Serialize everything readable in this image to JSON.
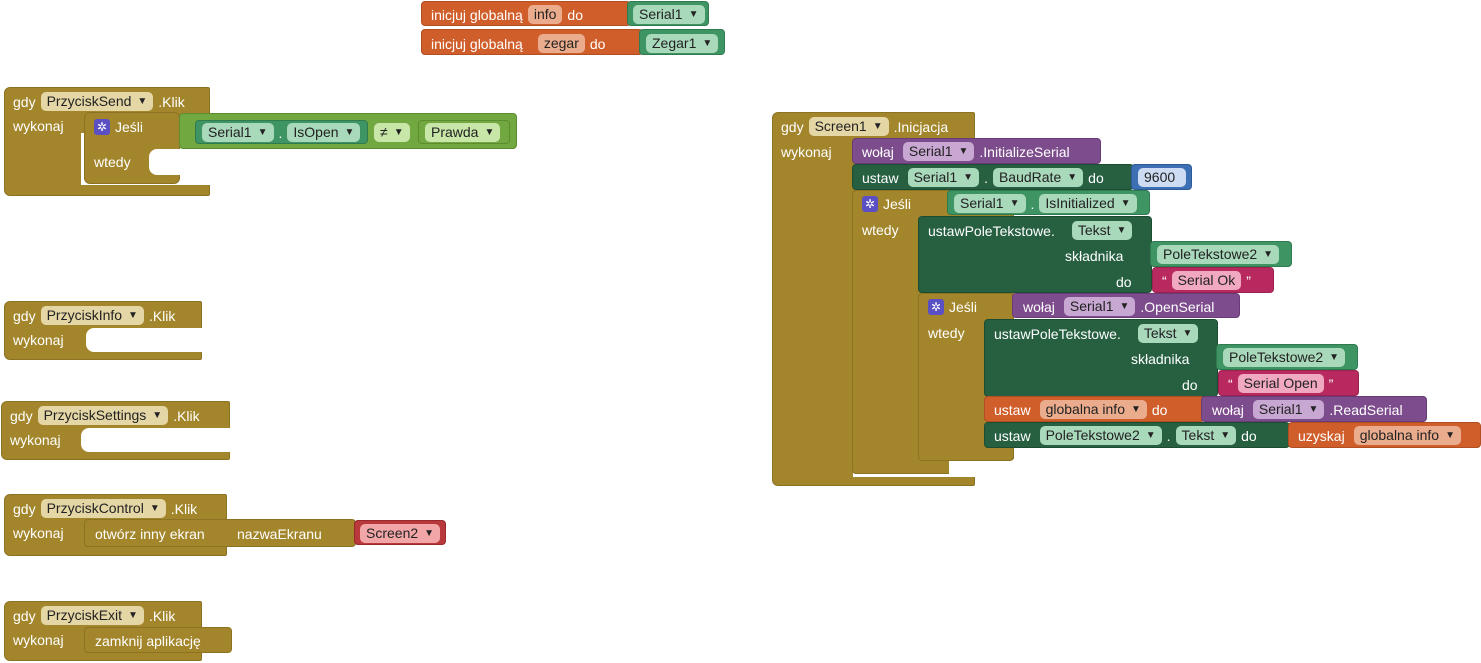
{
  "globals": {
    "g1": {
      "label": "inicjuj globalną",
      "name": "info",
      "do": "do",
      "value": "Serial1"
    },
    "g2": {
      "label": "inicjuj globalną",
      "name": "zegar",
      "do": "do",
      "value": "Zegar1"
    }
  },
  "evSend": {
    "gdy": "gdy",
    "component": "PrzyciskSend",
    ".klik": ".Klik",
    "wykonaj": "wykonaj",
    "if": "Jeśli",
    "wtedy": "wtedy",
    "cond": {
      "comp": "Serial1",
      "dot": ".",
      "prop": "IsOpen",
      "op": "≠",
      "val": "Prawda"
    }
  },
  "evInfo": {
    "gdy": "gdy",
    "component": "PrzyciskInfo",
    ".klik": ".Klik",
    "wykonaj": "wykonaj"
  },
  "evSettings": {
    "gdy": "gdy",
    "component": "PrzyciskSettings",
    ".klik": ".Klik",
    "wykonaj": "wykonaj"
  },
  "evControl": {
    "gdy": "gdy",
    "component": "PrzyciskControl",
    ".klik": ".Klik",
    "wykonaj": "wykonaj",
    "action": "otwórz inny ekran",
    "param": "nazwaEkranu",
    "screen": "Screen2"
  },
  "evExit": {
    "gdy": "gdy",
    "component": "PrzyciskExit",
    ".klik": ".Klik",
    "wykonaj": "wykonaj",
    "action": "zamknij aplikację"
  },
  "screenInit": {
    "gdy": "gdy",
    "component": "Screen1",
    "event": ".Inicjacja",
    "wykonaj": "wykonaj",
    "call1": {
      "wolaj": "wołaj",
      "comp": "Serial1",
      "method": ".InitializeSerial"
    },
    "set1": {
      "ustaw": "ustaw",
      "comp": "Serial1",
      "dot": ".",
      "prop": "BaudRate",
      "do": "do",
      "val": "9600"
    },
    "if1": {
      "if": "Jeśli",
      "comp": "Serial1",
      "dot": ".",
      "prop": "IsInitialized",
      "wtedy": "wtedy"
    },
    "setText1": {
      "label": "ustawPoleTekstowe.",
      "prop": "Tekst",
      "skladnika": "składnika",
      "comp": "PoleTekstowe2",
      "do": "do",
      "q1": "“",
      "text": "Serial Ok",
      "q2": "”"
    },
    "if2": {
      "if": "Jeśli",
      "wolaj": "wołaj",
      "comp": "Serial1",
      "method": ".OpenSerial",
      "wtedy": "wtedy"
    },
    "setText2": {
      "label": "ustawPoleTekstowe.",
      "prop": "Tekst",
      "skladnika": "składnika",
      "comp": "PoleTekstowe2",
      "do": "do",
      "q1": "“",
      "text": "Serial Open",
      "q2": "”"
    },
    "setGlobal": {
      "ustaw": "ustaw",
      "var": "globalna info",
      "do": "do",
      "wolaj": "wołaj",
      "comp": "Serial1",
      "method": ".ReadSerial"
    },
    "setField": {
      "ustaw": "ustaw",
      "comp": "PoleTekstowe2",
      "dot": ".",
      "prop": "Tekst",
      "do": "do",
      "get": "uzyskaj",
      "var": "globalna info"
    }
  },
  "colors": {
    "event": "#a3862b",
    "variable": "#d05e2b",
    "component": "#3f9464",
    "setter": "#266041",
    "logic": "#72a840",
    "call": "#7d4c8c",
    "text": "#b82a5f",
    "number": "#3d6fb5",
    "screen": "#b8383b"
  },
  "icons": {
    "dropdown": "chevron-down-icon",
    "mutator": "gear-icon"
  }
}
